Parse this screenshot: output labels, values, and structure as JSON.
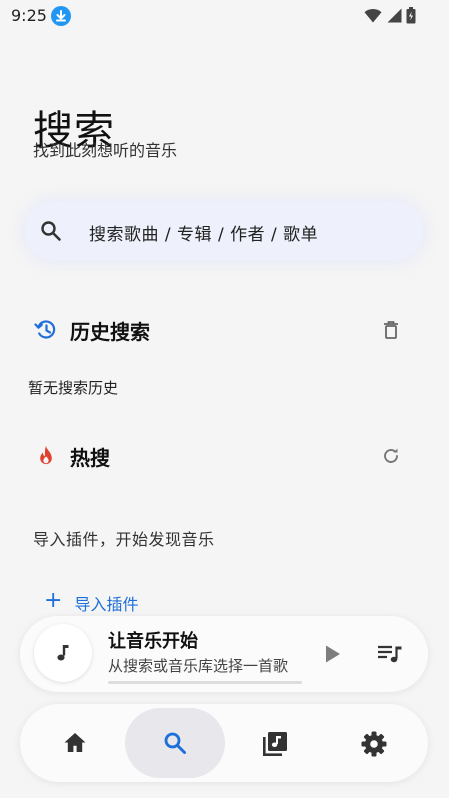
{
  "status_bar": {
    "time": "9:25",
    "icons": [
      "download-badge-icon",
      "wifi-icon",
      "cell-signal-icon",
      "battery-icon"
    ]
  },
  "page": {
    "title": "搜索",
    "subtitle": "找到此刻想听的音乐"
  },
  "search": {
    "placeholder": "搜索歌曲 / 专辑 / 作者 / 歌单",
    "icon": "search-icon"
  },
  "history": {
    "title": "历史搜索",
    "icon": "history-icon",
    "action_icon": "delete-icon",
    "empty_text": "暂无搜索历史"
  },
  "hot": {
    "title": "热搜",
    "icon": "fire-icon",
    "action_icon": "refresh-icon",
    "hint": "导入插件，开始发现音乐",
    "import_label": "导入插件",
    "import_icon": "plus-icon"
  },
  "mini_player": {
    "title": "让音乐开始",
    "subtitle": "从搜索或音乐库选择一首歌",
    "progress": 0,
    "cover_icon": "music-note-icon",
    "play_icon": "play-icon",
    "queue_icon": "queue-music-icon"
  },
  "bottom_nav": {
    "items": [
      {
        "icon": "home-icon",
        "active": false
      },
      {
        "icon": "search-icon",
        "active": true
      },
      {
        "icon": "library-music-icon",
        "active": false
      },
      {
        "icon": "settings-icon",
        "active": false
      }
    ]
  },
  "colors": {
    "accent": "#1e6fd9",
    "fire": "#e0412e",
    "search_bar_bg": "#eef0fb",
    "page_bg": "#f5f5f5",
    "active_nav_bg": "#e7e7ec",
    "download_badge": "#2196f3"
  }
}
